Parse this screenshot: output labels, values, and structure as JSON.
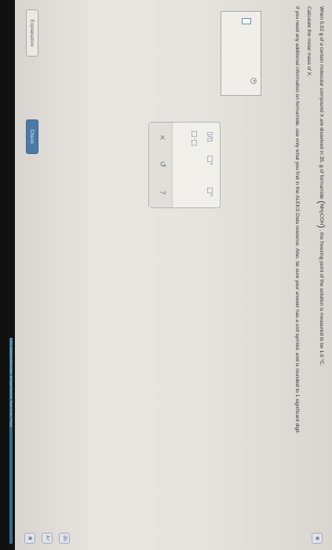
{
  "question": {
    "line1_prefix": "When 5.02 g of a certain molecular compound X are dissolved in 35. g of formamide",
    "formula_base": "NH",
    "formula_sub": "2",
    "formula_rest": "COH",
    "line1_suffix": ", the freezing point of the solution is measured to be 1.6 °C.",
    "line2": "Calculate the molar mass of X.",
    "line3": "If you need any additional information on formamide, use only what you find in the ALEKS Data resource. Also, be sure your answer has a unit symbol, and is rounded to 1 significant digit."
  },
  "tools": {
    "fraction": "▯/▯",
    "exponent": "□ˣ",
    "superscript": "□ⁿ",
    "times_ten": "□·□",
    "clear": "×",
    "undo": "↺",
    "help": "?"
  },
  "buttons": {
    "explanation": "Explanation",
    "check": "Check"
  },
  "side_icons": [
    "▦",
    "dh",
    "Ar",
    "▦"
  ],
  "footer": {
    "copyright": "© 2021 McGraw Hill Education. All Rights Reserved.   Terms of Use  |  Privacy"
  },
  "colors": {
    "check_button": "#4b7aa8",
    "page_background": "#e6e3de",
    "screen_bezel": "#1a1a1a"
  }
}
